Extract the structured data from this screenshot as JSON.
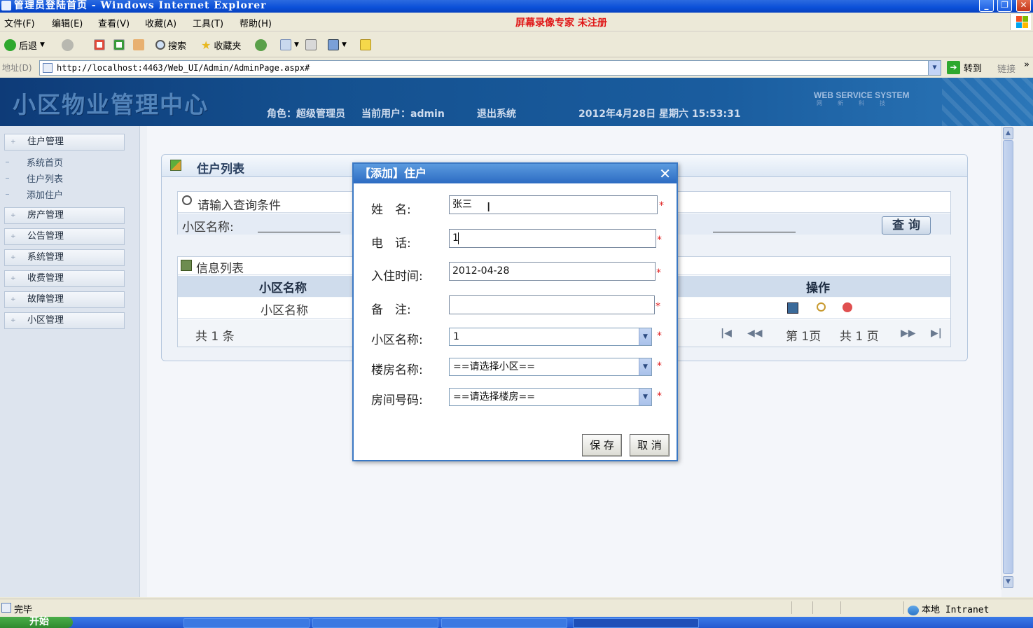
{
  "window": {
    "title": "管理员登陆首页 - Windows Internet Explorer",
    "minimize": "_",
    "restore": "❐",
    "close": "✕"
  },
  "menu": {
    "items": [
      "文件(F)",
      "编辑(E)",
      "查看(V)",
      "收藏(A)",
      "工具(T)",
      "帮助(H)"
    ],
    "banner": "屏幕录像专家 未注册"
  },
  "toolbar": {
    "back": "后退",
    "search": "搜索",
    "favorites": "收藏夹"
  },
  "address": {
    "label": "地址(D)",
    "url": "http://localhost:4463/Web_UI/Admin/AdminPage.aspx#",
    "go": "转到",
    "links": "链接",
    "more": "»"
  },
  "header": {
    "logo": "小区物业管理中心",
    "role": "角色：超级管理员",
    "current_user": "当前用户：admin",
    "logout": "退出系统",
    "datetime": "2012年4月28日 星期六 15:53:31",
    "ws_title": "WEB SERVICE SYSTEM",
    "ws_sub": "网新科技"
  },
  "sidebar": {
    "sections": [
      {
        "label": "住户管理",
        "items": [
          "系统首页",
          "住户列表",
          "添加住户"
        ]
      },
      {
        "label": "房产管理"
      },
      {
        "label": "公告管理"
      },
      {
        "label": "系统管理"
      },
      {
        "label": "收费管理"
      },
      {
        "label": "故障管理"
      },
      {
        "label": "小区管理"
      }
    ]
  },
  "panel": {
    "title": "住户列表",
    "query": {
      "heading": "请输入查询条件",
      "field_label": "小区名称:",
      "button": "查 询"
    },
    "list": {
      "heading": "信息列表",
      "columns": [
        "小区名称",
        "操作"
      ],
      "rows": [
        [
          "小区名称"
        ]
      ],
      "total": "共 1 条",
      "page_current": "第 1页",
      "page_total": "共 1 页"
    }
  },
  "modal": {
    "title": "【添加】住户",
    "close": "✕",
    "fields": {
      "name_label": "姓　名:",
      "name_value": "张三",
      "phone_label": "电　话:",
      "phone_value": "1",
      "date_label": "入住时间:",
      "date_value": "2012-04-28",
      "note_label": "备　注:",
      "note_value": "",
      "community_label": "小区名称:",
      "community_value": "1",
      "building_label": "楼房名称:",
      "building_value": "==请选择小区==",
      "room_label": "房间号码:",
      "room_value": "==请选择楼房=="
    },
    "required_mark": "*",
    "save": "保 存",
    "cancel": "取 消"
  },
  "status": {
    "text": "完毕",
    "zone": "本地 Intranet"
  },
  "taskbar": {
    "start": "开始"
  },
  "colors": {
    "header_blue": "#14508f",
    "modal_title": "#2c6bc2",
    "required": "#e02020",
    "banner": "#e01818"
  }
}
